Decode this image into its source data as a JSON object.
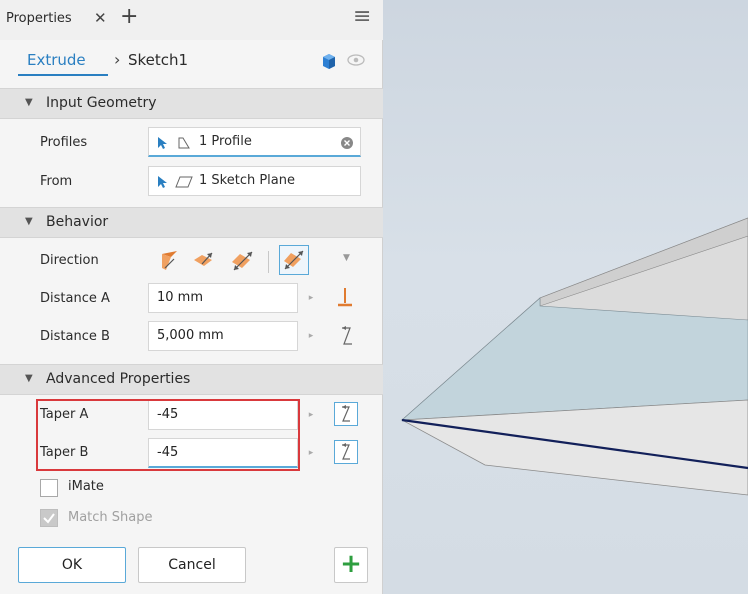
{
  "header": {
    "tab_label": "Properties",
    "close_glyph": "✕",
    "add_glyph": "+",
    "menu_glyph": "≡"
  },
  "breadcrumb": {
    "feature": "Extrude",
    "separator": "›",
    "sketch": "Sketch1"
  },
  "sections": {
    "input_geometry": "Input Geometry",
    "behavior": "Behavior",
    "advanced": "Advanced Properties"
  },
  "input_geometry": {
    "profiles_label": "Profiles",
    "profiles_value": "1 Profile",
    "from_label": "From",
    "from_value": "1 Sketch Plane"
  },
  "behavior": {
    "direction_label": "Direction",
    "distance_a_label": "Distance A",
    "distance_a_value": "10 mm",
    "distance_b_label": "Distance B",
    "distance_b_value": "5,000 mm"
  },
  "advanced": {
    "taper_a_label": "Taper A",
    "taper_a_value": "-45",
    "taper_b_label": "Taper B",
    "taper_b_value": "-45",
    "imate_label": "iMate",
    "imate_checked": false,
    "match_shape_label": "Match Shape",
    "match_shape_checked": true
  },
  "footer": {
    "ok_label": "OK",
    "cancel_label": "Cancel",
    "plus_glyph": "+"
  },
  "colors": {
    "accent_blue": "#2a7fc1",
    "highlight_red": "#d9393c",
    "plus_green": "#2e9e3f",
    "arrow_orange": "#e07b30"
  }
}
